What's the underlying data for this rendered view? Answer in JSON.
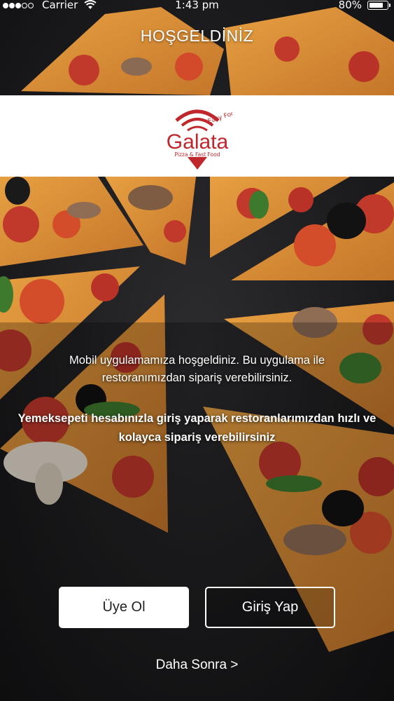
{
  "status_bar": {
    "carrier": "Carrier",
    "time": "1:43 pm",
    "battery_percent": "80%",
    "battery_level": 0.8,
    "signal_bars_filled": 3,
    "signal_bars_total": 5
  },
  "header": {
    "title": "HOŞGELDİNİZ"
  },
  "logo": {
    "brand": "Galata",
    "tagline_top": "Easy Food",
    "tagline_bottom": "Pizza & Fast Food",
    "color": "#c0272d"
  },
  "content": {
    "intro_text": "Mobil uygulamamıza  hoşgeldiniz. Bu uygulama ile restoranımızdan sipariş verebilirsiniz.",
    "intro_bold_text": "Yemeksepeti hesabınızla giriş yaparak restoranlarımızdan hızlı ve kolayca sipariş verebilirsiniz"
  },
  "actions": {
    "register_label": "Üye Ol",
    "login_label": "Giriş Yap",
    "later_label": "Daha Sonra >"
  }
}
